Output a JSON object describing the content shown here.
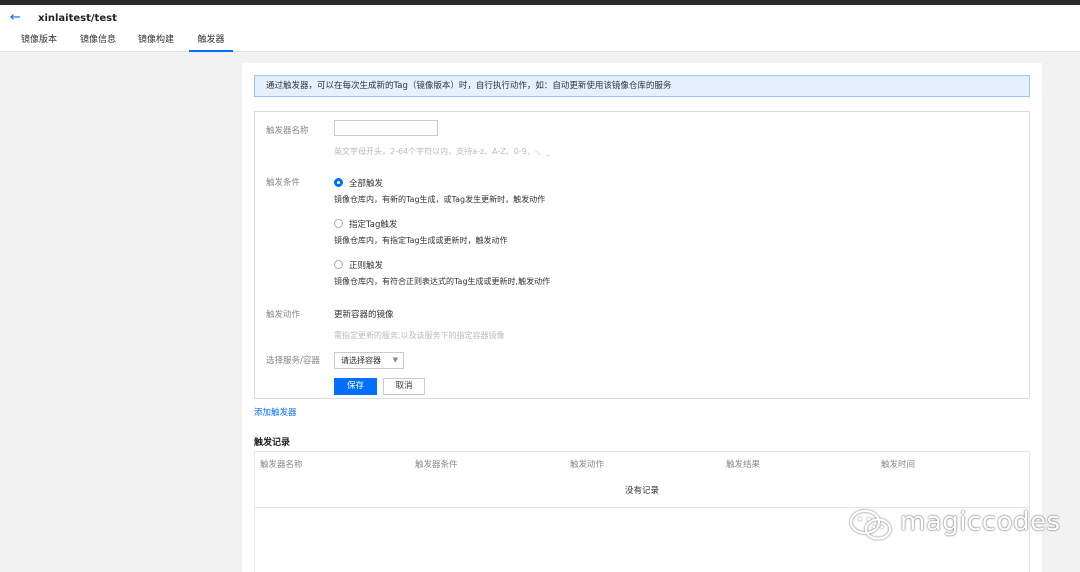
{
  "header": {
    "title": "xinlaitest/test",
    "tabs": [
      {
        "label": "镜像版本",
        "active": false
      },
      {
        "label": "镜像信息",
        "active": false
      },
      {
        "label": "镜像构建",
        "active": false
      },
      {
        "label": "触发器",
        "active": true
      }
    ]
  },
  "banner": {
    "text": "通过触发器，可以在每次生成新的Tag（镜像版本）时，自行执行动作，如：自动更新使用该镜像仓库的服务"
  },
  "form": {
    "name": {
      "label": "触发器名称",
      "value": "",
      "hint": "英文字母开头，2-64个字符以内，支持a-z、A-Z、0-9、-、_"
    },
    "condition": {
      "label": "触发条件",
      "options": [
        {
          "label": "全部触发",
          "desc": "镜像仓库内，有新的Tag生成，或Tag发生更新时，触发动作",
          "checked": true
        },
        {
          "label": "指定Tag触发",
          "desc": "镜像仓库内，有指定Tag生成或更新时，触发动作",
          "checked": false
        },
        {
          "label": "正则触发",
          "desc": "镜像仓库内，有符合正则表达式的Tag生成或更新时,触发动作",
          "checked": false
        }
      ]
    },
    "action": {
      "label": "触发动作",
      "value": "更新容器的镜像",
      "hint": "需指定更新的服务,以及该服务下的指定容器镜像"
    },
    "service": {
      "label": "选择服务/容器",
      "selected": "请选择容器"
    },
    "buttons": {
      "save": "保存",
      "cancel": "取消"
    }
  },
  "add_trigger_link": "添加触发器",
  "records": {
    "title": "触发记录",
    "columns": [
      "触发器名称",
      "触发器条件",
      "触发动作",
      "触发结果",
      "触发时间"
    ],
    "empty_text": "没有记录"
  },
  "watermark": {
    "text": "magiccodes",
    "icon": "wechat-icon"
  },
  "colors": {
    "accent": "#006eff",
    "banner_bg": "#e5f0ff",
    "banner_border": "#97c7ff"
  }
}
